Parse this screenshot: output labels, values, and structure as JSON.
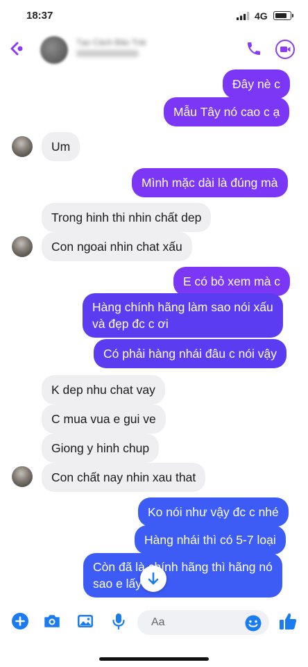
{
  "status_bar": {
    "time": "18:37",
    "network": "4G"
  },
  "header": {
    "contact_name": "Tạo Cách Bảo Trái"
  },
  "messages": [
    {
      "side": "out",
      "text": "Đây nè c"
    },
    {
      "side": "out",
      "text": "Mẫu Tây nó cao c ạ"
    },
    {
      "side": "in",
      "text": "Um"
    },
    {
      "side": "out",
      "text": "Mình mặc dài là đúng mà"
    },
    {
      "side": "in",
      "text": "Trong hinh thi nhin chất dep"
    },
    {
      "side": "in",
      "text": "Con ngoai nhin chat xấu"
    },
    {
      "side": "out",
      "text": "E có bỏ xem mà c"
    },
    {
      "side": "out",
      "lines": [
        "Hàng chính hãng làm sao nói xấu",
        "và đẹp đc c ơi"
      ]
    },
    {
      "side": "out",
      "text": "Có phải hàng nhái đâu c nói vậy"
    },
    {
      "side": "in",
      "text": "K dep nhu chat vay"
    },
    {
      "side": "in",
      "text": "C mua vua e gui ve"
    },
    {
      "side": "in",
      "text": "Giong y hinh chup"
    },
    {
      "side": "in",
      "text": "Con chất nay  nhin xau that"
    },
    {
      "side": "out",
      "text": "Ko nói như vậy đc c nhé"
    },
    {
      "side": "out",
      "text": "Hàng nhái thì có 5-7 loại"
    },
    {
      "side": "out",
      "lines": [
        "Còn đã là chính hãng thì hãng nó",
        "sao e lấy"
      ]
    }
  ],
  "composer": {
    "placeholder": "Aa"
  },
  "colors": {
    "accent_purple": "#7b37f5",
    "accent_blue": "#3d5cf5",
    "incoming_bg": "#efeff2",
    "icon_blue": "#1a7cf0"
  },
  "icons": [
    "back-icon",
    "call-icon",
    "video-call-icon",
    "plus-icon",
    "camera-icon",
    "gallery-icon",
    "microphone-icon",
    "emoji-icon",
    "like-icon",
    "arrow-down-icon"
  ]
}
